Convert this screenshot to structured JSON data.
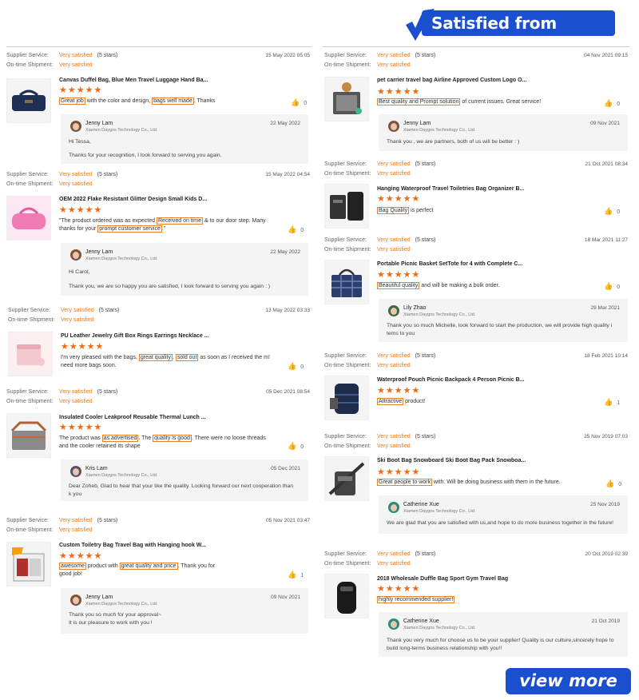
{
  "banner": {
    "title": "Satisfied from Clients"
  },
  "labels": {
    "supplier_service": "Supplier Service:",
    "ontime_shipment": "On-time Shipment:",
    "stars_text": "(5 stars)",
    "rating_value": "Very satisfied",
    "stars": "★★★★★",
    "company": "Xiamen Daygos Technology Co., Ltd."
  },
  "footer": {
    "view_more": "view more >>"
  },
  "reviews_left": [
    {
      "date": "15 May 2022 05:05",
      "title": "Canvas Duffel Bag, Blue Men Travel Luggage Hand Ba...",
      "text_before": "",
      "hl1": "Great job",
      "text_mid": " with the color and design, ",
      "hl2": "bags well made",
      "text_after": ". Thanks",
      "likes": "0",
      "reply": {
        "name": "Jenny Lam",
        "date": "22 May 2022",
        "line1": "Hi Tessa,",
        "line2": "Thanks for your recognition, I look forward to serving you again."
      }
    },
    {
      "date": "15 May 2022 04:54",
      "title": "OEM 2022 Flake Resistant Glitter Design Small Kids D...",
      "text_before": "\"The product ordered was as expected ",
      "hl1": "Received on time",
      "text_mid": " & to our door step. Many thanks for your ",
      "hl2": "prompt customer service",
      "text_after": ".\"",
      "likes": "0",
      "reply": {
        "name": "Jenny Lam",
        "date": "22 May 2022",
        "line1": "Hi Carol,",
        "line2": "Thank you, we are so happy you are satisfied, I look forward to serving you again : )"
      }
    },
    {
      "date": "13 May 2022 03:33",
      "title": "PU Leather Jewelry Gift Box Rings Earrings Necklace ...",
      "text_before": "I'm very pleased with the bags, ",
      "hl1": "great quality",
      "text_mid": ", ",
      "hl2": "sold out",
      "text_after": " as soon as I received the m! need more bags soon.",
      "likes": "0"
    },
    {
      "date": "05 Dec 2021 08:54",
      "title": "Insulated Cooler Leakproof Reusable Thermal Lunch ...",
      "text_before": "The product was ",
      "hl1": "as advertised",
      "text_mid": ". The ",
      "hl2": "quality is good",
      "text_after": ". There were no loose threads and the cooler retained its shape",
      "likes": "0",
      "reply": {
        "name": "Kris Lam",
        "date": "05 Dec 2021",
        "line1": "Dear Zoheb, Glad to hear that your like the quality. Looking forward our next cooperation  than",
        "line2": "k you"
      }
    },
    {
      "date": "05 Nov 2021 03:47",
      "title": "Custom Toiletry Bag Travel Bag with Hanging hook W...",
      "text_before": "",
      "hl1": "awesome",
      "text_mid": " product with ",
      "hl2": "great quality and price",
      "text_after": ". Thank you for good job!",
      "likes": "1",
      "reply": {
        "name": "Jenny Lam",
        "date": "09 Nov 2021",
        "line1": "Thank you so much for your approval~",
        "line2": "It is our pleasure to work with you !"
      }
    }
  ],
  "reviews_right": [
    {
      "date": "04 Nov 2021 09:15",
      "title": "pet carrier travel bag Airline Approved Custom Logo O...",
      "hl1": "Best quality and Prompt solution",
      "text_after": " of current issues. Great service!",
      "likes": "0",
      "reply": {
        "name": "Jenny Lam",
        "date": "09 Nov 2021",
        "line1": "Thank you , we are partners, both of us will be better : )",
        "line2": ""
      }
    },
    {
      "date": "21 Oct 2021 08:34",
      "title": "Hanging Waterproof Travel Toiletries Bag Organizer B...",
      "hl1": "Bag Quality",
      "text_after": " is perfect",
      "likes": "0"
    },
    {
      "date": "18 Mar 2021 11:27",
      "title": "Portable Picnic Basket SetTote for 4 with Complete C...",
      "hl1": "Beautiful quality",
      "text_after": " and will be making a bulk order.",
      "likes": "0",
      "reply": {
        "name": "Lily Zhao",
        "date": "29 Mar 2021",
        "line1": "Thank you so much Michelle, look forward to start the production, we will provide high quality i",
        "line2": "tems to you"
      }
    },
    {
      "date": "18 Feb 2021 10:14",
      "title": "Waterproof Pouch Picnic Backpack 4 Person Picnic B...",
      "hl1": "Attractive",
      "text_after": " product!",
      "likes": "1"
    },
    {
      "date": "25 Nov 2019 07:03",
      "title": "Ski Boot Bag Snowboard Ski Boot Bag Pack Snowboa...",
      "hl1": "Great people to work",
      "text_after": " with. Will be doing business with them in the future.",
      "likes": "0",
      "reply": {
        "name": "Catherine Xue",
        "date": "25 Nov 2019",
        "line1": "We are glad that you are satisfied with us,and hope to do more business together in the future!",
        "line2": ""
      }
    },
    {
      "date": "20 Oct 2019 02:39",
      "title": "2018 Wholesale Duffle Bag Sport Gym Travel Bag",
      "hl1": "highly recommended supplier!",
      "text_after": "",
      "likes": "",
      "reply": {
        "name": "Catherine Xue",
        "date": "21 Oct 2019",
        "line1": "Thank you very much for choose us to be your supplier! Quality is our culture,sincerely hope to",
        "line2": "build long-terms business relationship with you!!"
      }
    }
  ]
}
